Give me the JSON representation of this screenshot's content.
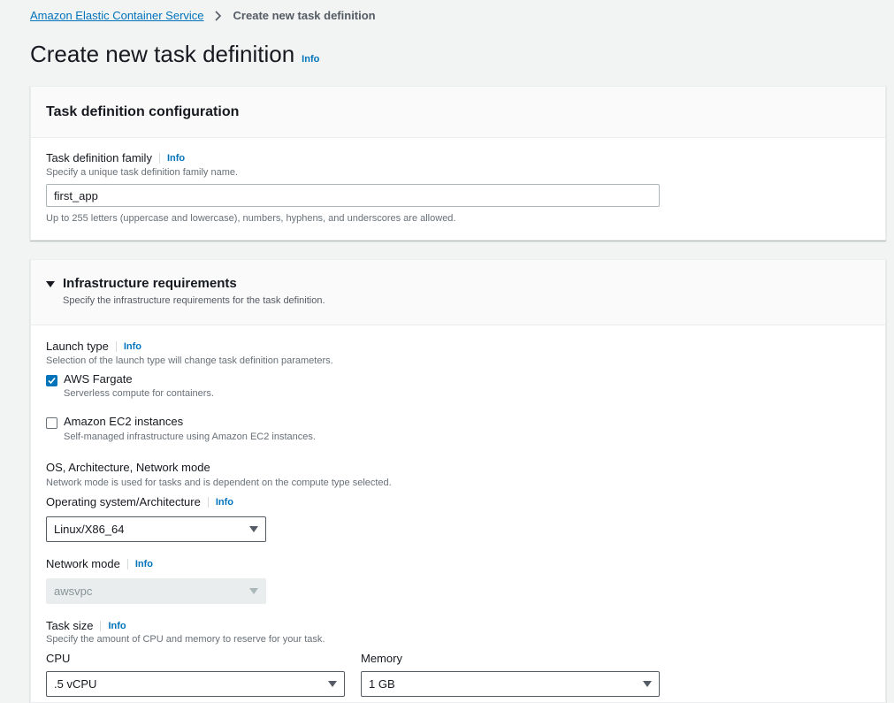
{
  "breadcrumb": {
    "root": "Amazon Elastic Container Service",
    "current": "Create new task definition"
  },
  "page": {
    "title": "Create new task definition",
    "info": "Info"
  },
  "task_def_config": {
    "heading": "Task definition configuration",
    "family_label": "Task definition family",
    "family_info": "Info",
    "family_desc": "Specify a unique task definition family name.",
    "family_value": "first_app",
    "family_constraint": "Up to 255 letters (uppercase and lowercase), numbers, hyphens, and underscores are allowed."
  },
  "infra": {
    "heading": "Infrastructure requirements",
    "subheading": "Specify the infrastructure requirements for the task definition.",
    "launch_type_label": "Launch type",
    "launch_type_info": "Info",
    "launch_type_desc": "Selection of the launch type will change task definition parameters.",
    "options": [
      {
        "label": "AWS Fargate",
        "desc": "Serverless compute for containers.",
        "checked": true
      },
      {
        "label": "Amazon EC2 instances",
        "desc": "Self-managed infrastructure using Amazon EC2 instances.",
        "checked": false
      }
    ],
    "os_group_label": "OS, Architecture, Network mode",
    "os_group_desc": "Network mode is used for tasks and is dependent on the compute type selected.",
    "os_label": "Operating system/Architecture",
    "os_info": "Info",
    "os_value": "Linux/X86_64",
    "network_label": "Network mode",
    "network_info": "Info",
    "network_value": "awsvpc",
    "task_size_label": "Task size",
    "task_size_info": "Info",
    "task_size_desc": "Specify the amount of CPU and memory to reserve for your task.",
    "cpu_label": "CPU",
    "cpu_value": ".5 vCPU",
    "memory_label": "Memory",
    "memory_value": "1 GB"
  },
  "colors": {
    "link": "#0073bb",
    "checkbox_checked": "#0073bb",
    "page_bg": "#f2f3f3"
  }
}
